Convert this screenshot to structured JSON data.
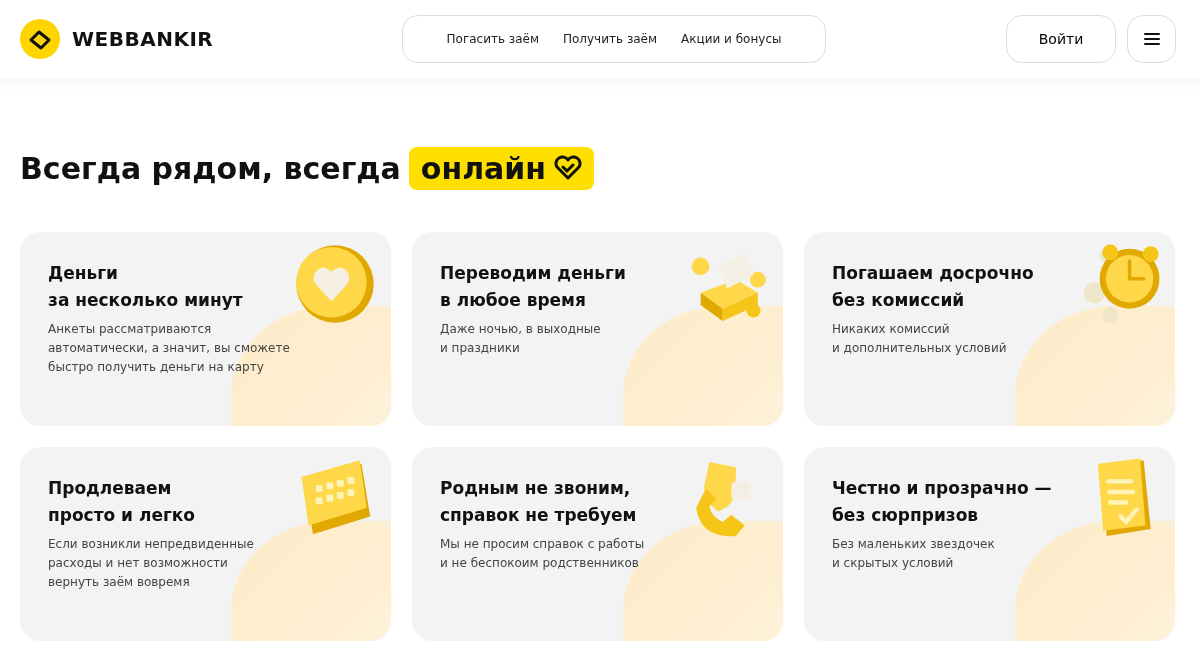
{
  "header": {
    "logo": "WEBBANKIR",
    "nav": [
      "Погасить заём",
      "Получить заём",
      "Акции и бонусы"
    ],
    "login": "Войти"
  },
  "hero": {
    "title": "Всегда рядом, всегда",
    "highlight": "онлайн"
  },
  "cards": [
    {
      "kind": "coin",
      "title": "Деньги\nза несколько минут",
      "text": "Анкеты рассматриваются\nавтоматически, а значит, вы сможете\nбыстро получить деньги на карту"
    },
    {
      "kind": "money",
      "title": "Переводим деньги\nв любое время",
      "text": "Даже ночью, в выходные\nи праздники"
    },
    {
      "kind": "clock",
      "title": "Погашаем досрочно\nбез комиссий",
      "text": "Никаких комиссий\nи дополнительных условий"
    },
    {
      "kind": "calendar",
      "title": "Продлеваем\nпросто и легко",
      "text": "Если возникли непредвиденные\nрасходы и нет возможности\nвернуть заём вовремя"
    },
    {
      "kind": "phone",
      "title": "Родным не звоним,\nсправок не требуем",
      "text": "Мы не просим справок с работы\nи не беспокоим родственников"
    },
    {
      "kind": "document",
      "title": "Честно и прозрачно —\nбез сюрпризов",
      "text": "Без маленьких звездочек\nи скрытых условий"
    }
  ]
}
